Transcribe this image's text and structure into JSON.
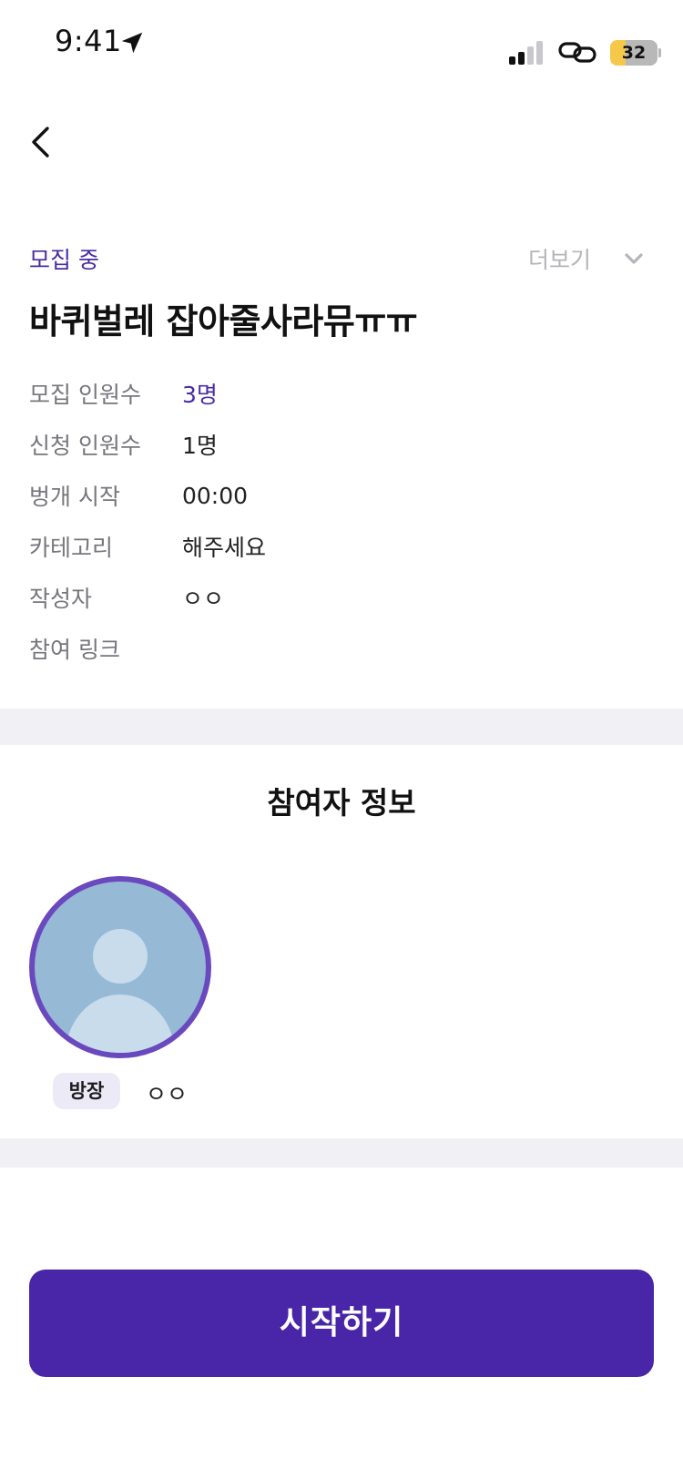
{
  "status_bar": {
    "time": "9:41",
    "battery_level": "32",
    "battery_color": "#f5c84a"
  },
  "header": {
    "status": "모집 중",
    "more_label": "더보기",
    "title": "바퀴벌레 잡아줄사라뮤ㅠㅠ"
  },
  "info": [
    {
      "label": "모집 인원수",
      "value": "3명"
    },
    {
      "label": "신청 인원수",
      "value": "1명"
    },
    {
      "label": "벙개 시작",
      "value": "00:00"
    },
    {
      "label": "카테고리",
      "value": "해주세요"
    },
    {
      "label": "작성자",
      "value": "ㅇㅇ"
    },
    {
      "label": "참여 링크",
      "value": ""
    }
  ],
  "participants": {
    "section_title": "참여자 정보",
    "list": [
      {
        "role": "방장",
        "name": "ㅇㅇ"
      }
    ]
  },
  "actions": {
    "start_label": "시작하기"
  },
  "colors": {
    "accent": "#4925a8",
    "accent_text": "#4a2ba5",
    "avatar_border": "#6a48be",
    "divider": "#f1f1f5"
  },
  "icons": [
    "location-arrow-icon",
    "signal-icon",
    "link-icon",
    "back-chevron-icon",
    "chevron-down-icon",
    "user-silhouette-icon"
  ]
}
